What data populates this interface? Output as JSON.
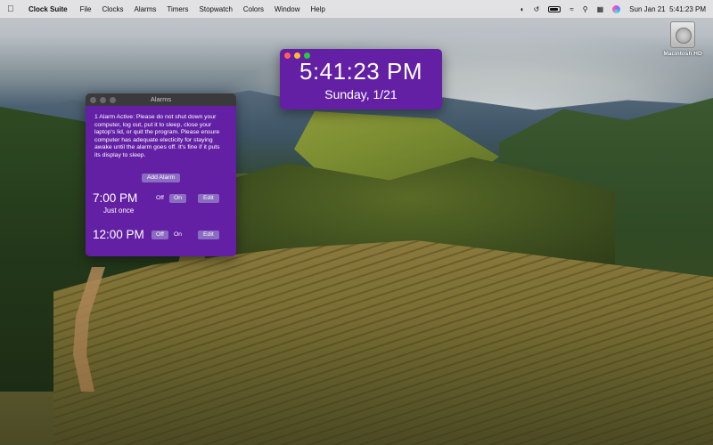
{
  "menubar": {
    "app_name": "Clock Suite",
    "items": [
      "File",
      "Clocks",
      "Alarms",
      "Timers",
      "Stopwatch",
      "Colors",
      "Window",
      "Help"
    ],
    "datetime": "Sun Jan 21  5:41:23 PM"
  },
  "desktop": {
    "disk_label": "Macintosh HD"
  },
  "clock_window": {
    "time": "5:41:23 PM",
    "date": "Sunday, 1/21",
    "background_color": "#6320a5"
  },
  "alarms_window": {
    "title": "Alarms",
    "notice": "1 Alarm Active: Please do not shut down your computer, log out, put it to sleep, close your laptop's lid, or quit the program.  Please ensure computer has adequate electicity for staying awake until the alarm goes off.  It's fine if it puts its display to sleep.",
    "add_button": "Add Alarm",
    "alarms": [
      {
        "time": "7:00 PM",
        "repeat": "Just once",
        "off_label": "Off",
        "on_label": "On",
        "selected": "On",
        "edit_label": "Edit"
      },
      {
        "time": "12:00 PM",
        "repeat": "",
        "off_label": "Off",
        "on_label": "On",
        "selected": "Off",
        "edit_label": "Edit"
      }
    ]
  },
  "colors": {
    "window_purple": "#6320a5",
    "button_purple": "#8a6cc0",
    "titlebar_dark": "#3a3a3c"
  }
}
